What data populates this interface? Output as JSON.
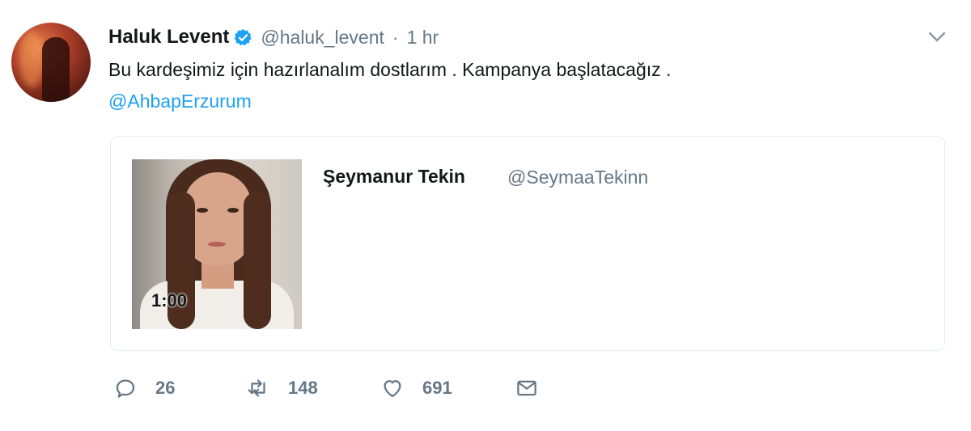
{
  "tweet": {
    "author_name": "Haluk Levent",
    "author_handle": "@haluk_levent",
    "separator": "·",
    "time": "1 hr",
    "text": "Bu kardeşimiz için hazırlanalım dostlarım . Kampanya başlatacağız .",
    "mention": "@AhbapErzurum",
    "icons": {
      "verified": "verified-badge-icon",
      "more": "chevron-down-icon"
    }
  },
  "quoted": {
    "author_name": "Şeymanur Tekin",
    "author_handle": "@SeymaaTekinn",
    "video_duration": "1:00"
  },
  "actions": {
    "reply_count": "26",
    "retweet_count": "148",
    "like_count": "691",
    "icons": [
      "reply-icon",
      "retweet-icon",
      "like-icon",
      "direct-message-icon"
    ]
  },
  "colors": {
    "accent": "#1da1f2",
    "secondary_text": "#657786",
    "primary_text": "#14171a",
    "border": "#e6ecf0"
  }
}
